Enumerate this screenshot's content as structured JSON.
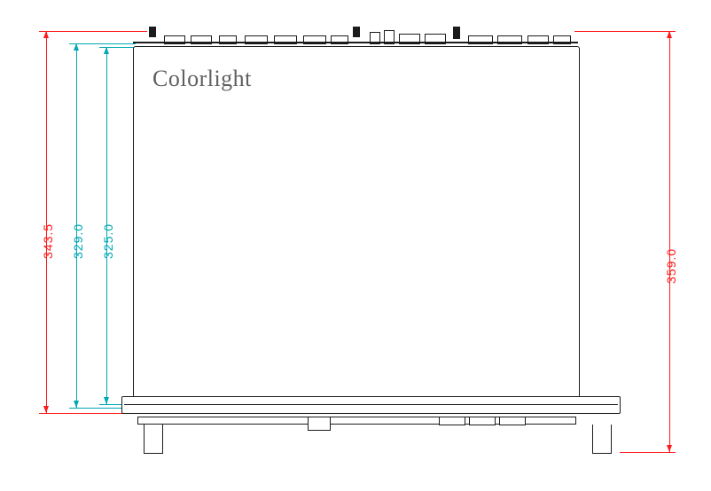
{
  "brand": "Colorlight",
  "dimensions": {
    "left_outer": "343.5",
    "left_mid": "329.0",
    "left_inner": "325.0",
    "right": "359.0"
  },
  "colors": {
    "red": "#ff1a1a",
    "cyan": "#00a8b4",
    "line": "#1b1b1b"
  }
}
